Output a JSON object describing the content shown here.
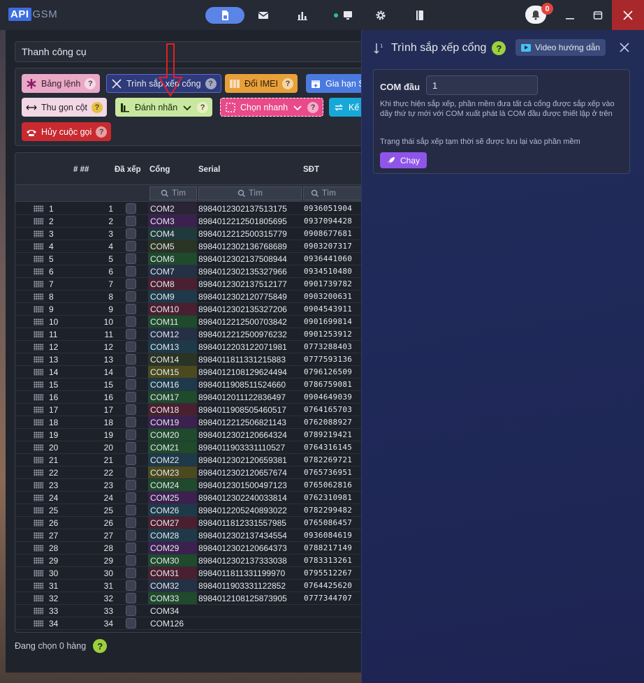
{
  "app": {
    "logo_api": "API",
    "logo_gsm": "GSM",
    "notifications_count": "0"
  },
  "toolbar": {
    "select_value": "Thanh công cụ"
  },
  "tools": [
    {
      "label": "Bảng lệnh"
    },
    {
      "label": "Trình sắp xếp cổng"
    },
    {
      "label": "Đổi IMEI"
    },
    {
      "label": "Gia hạn S"
    },
    {
      "label": "Thu gọn cột"
    },
    {
      "label": "Đánh nhãn"
    },
    {
      "label": "Chọn nhanh"
    },
    {
      "label": "Kế"
    },
    {
      "label": "Hủy cuộc gọi"
    }
  ],
  "grid": {
    "headers": {
      "index": "# ##",
      "sorted": "Đã xếp",
      "port": "Cổng",
      "serial": "Serial",
      "phone": "SĐT"
    },
    "filter_placeholder": "Tìm",
    "rows": [
      {
        "idx": "1",
        "num": "1",
        "port": "COM2",
        "serial": "8984012302137513175",
        "phone": "0936051904"
      },
      {
        "idx": "2",
        "num": "2",
        "port": "COM3",
        "serial": "8984012212501805695",
        "phone": "0937094428"
      },
      {
        "idx": "3",
        "num": "3",
        "port": "COM4",
        "serial": "8984012212500315779",
        "phone": "0908677681"
      },
      {
        "idx": "4",
        "num": "4",
        "port": "COM5",
        "serial": "8984012302136768689",
        "phone": "0903207317"
      },
      {
        "idx": "5",
        "num": "5",
        "port": "COM6",
        "serial": "8984012302137508944",
        "phone": "0936441060"
      },
      {
        "idx": "6",
        "num": "6",
        "port": "COM7",
        "serial": "8984012302135327966",
        "phone": "0934510480"
      },
      {
        "idx": "7",
        "num": "7",
        "port": "COM8",
        "serial": "8984012302137512177",
        "phone": "0901739782"
      },
      {
        "idx": "8",
        "num": "8",
        "port": "COM9",
        "serial": "8984012302120775849",
        "phone": "0903200631"
      },
      {
        "idx": "9",
        "num": "9",
        "port": "COM10",
        "serial": "8984012302135327206",
        "phone": "0904543911"
      },
      {
        "idx": "10",
        "num": "10",
        "port": "COM11",
        "serial": "8984012212500703842",
        "phone": "0901699814"
      },
      {
        "idx": "11",
        "num": "11",
        "port": "COM12",
        "serial": "8984012212500976232",
        "phone": "0901253912"
      },
      {
        "idx": "12",
        "num": "12",
        "port": "COM13",
        "serial": "8984012203122071981",
        "phone": "0773288403"
      },
      {
        "idx": "13",
        "num": "13",
        "port": "COM14",
        "serial": "8984011811331215883",
        "phone": "0777593136"
      },
      {
        "idx": "14",
        "num": "14",
        "port": "COM15",
        "serial": "8984012108129624494",
        "phone": "0796126509"
      },
      {
        "idx": "15",
        "num": "15",
        "port": "COM16",
        "serial": "8984011908511524660",
        "phone": "0786759081"
      },
      {
        "idx": "16",
        "num": "16",
        "port": "COM17",
        "serial": "8984012011122836497",
        "phone": "0904649039"
      },
      {
        "idx": "17",
        "num": "17",
        "port": "COM18",
        "serial": "8984011908505460517",
        "phone": "0764165703"
      },
      {
        "idx": "18",
        "num": "18",
        "port": "COM19",
        "serial": "8984012212506821143",
        "phone": "0762088927"
      },
      {
        "idx": "19",
        "num": "19",
        "port": "COM20",
        "serial": "8984012302120664324",
        "phone": "0789219421"
      },
      {
        "idx": "20",
        "num": "20",
        "port": "COM21",
        "serial": "8984011903331110527",
        "phone": "0764316145"
      },
      {
        "idx": "21",
        "num": "21",
        "port": "COM22",
        "serial": "8984012302120659381",
        "phone": "0782269721"
      },
      {
        "idx": "22",
        "num": "22",
        "port": "COM23",
        "serial": "8984012302120657674",
        "phone": "0765736951"
      },
      {
        "idx": "23",
        "num": "23",
        "port": "COM24",
        "serial": "8984012301500497123",
        "phone": "0765062816"
      },
      {
        "idx": "24",
        "num": "24",
        "port": "COM25",
        "serial": "8984012302240033814",
        "phone": "0762310981"
      },
      {
        "idx": "25",
        "num": "25",
        "port": "COM26",
        "serial": "8984012205240893022",
        "phone": "0782299482"
      },
      {
        "idx": "26",
        "num": "26",
        "port": "COM27",
        "serial": "8984011812331557985",
        "phone": "0765086457"
      },
      {
        "idx": "27",
        "num": "27",
        "port": "COM28",
        "serial": "8984012302137434554",
        "phone": "0936084619"
      },
      {
        "idx": "28",
        "num": "28",
        "port": "COM29",
        "serial": "8984012302120664373",
        "phone": "0788217149"
      },
      {
        "idx": "29",
        "num": "29",
        "port": "COM30",
        "serial": "8984012302137333038",
        "phone": "0783313261"
      },
      {
        "idx": "30",
        "num": "30",
        "port": "COM31",
        "serial": "8984011811331199970",
        "phone": "0795512267"
      },
      {
        "idx": "31",
        "num": "31",
        "port": "COM32",
        "serial": "8984011903331122852",
        "phone": "0764425620"
      },
      {
        "idx": "32",
        "num": "32",
        "port": "COM33",
        "serial": "8984012108125873905",
        "phone": "0777344707"
      },
      {
        "idx": "33",
        "num": "33",
        "port": "COM34",
        "serial": "",
        "phone": ""
      },
      {
        "idx": "34",
        "num": "34",
        "port": "COM126",
        "serial": "",
        "phone": ""
      }
    ]
  },
  "footer": {
    "selection_text": "Đang chọn 0 hàng"
  },
  "panel": {
    "title": "Trình sắp xếp cổng",
    "video_label": "Video hướng dẫn",
    "com_label": "COM đầu",
    "com_value": "1",
    "description": "Khi thực hiện sắp xếp, phần mềm đưa tất cả cổng được sắp xếp vào dãy thứ tự mới với COM xuất phát là COM đầu được thiết lập ở trên",
    "status_text": "Trạng thái sắp xếp tạm thời sẽ được lưu lại vào phần mềm",
    "run_label": "Chạy"
  },
  "colors": {
    "accent": "#5a84e8",
    "close_red": "#a8282b",
    "run_purple": "#8e55e8",
    "port_green": "#1f4a2c",
    "port_red": "#4a2030",
    "port_purple": "#3c2050",
    "port_olive": "#4a4a1e",
    "port_teal": "#1e3a4a"
  },
  "icons": [
    "sim-card-icon",
    "mail-icon",
    "bar-chart-icon",
    "monitor-icon",
    "gear-icon",
    "book-icon",
    "bell-icon",
    "minimize-icon",
    "restore-icon",
    "close-icon",
    "asterisk-icon",
    "x-icon",
    "barcode-icon",
    "calendar-plus-icon",
    "arrows-horizontal-icon",
    "label-icon",
    "select-dashed-icon",
    "refresh-icon",
    "phone-hangup-icon",
    "search-icon",
    "sort-icon",
    "youtube-icon",
    "rocket-icon"
  ]
}
